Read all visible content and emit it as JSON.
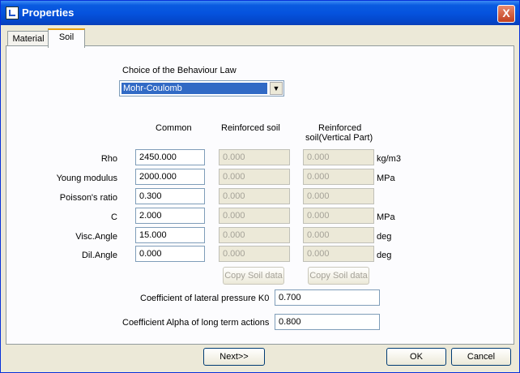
{
  "window": {
    "title": "Properties",
    "close_label": "X"
  },
  "tabs": [
    {
      "label": "Material"
    },
    {
      "label": "Soil"
    }
  ],
  "behaviour": {
    "label": "Choice of the Behaviour Law",
    "selected": "Mohr-Coulomb",
    "arrow": "▼"
  },
  "columns": {
    "common": "Common",
    "reinforced": "Reinforced soil",
    "vertical_line1": "Reinforced",
    "vertical_line2": "soil(Vertical Part)"
  },
  "rows": [
    {
      "label": "Rho",
      "common": "2450.000",
      "reinforced": "0.000",
      "vertical": "0.000",
      "unit": "kg/m3"
    },
    {
      "label": "Young modulus",
      "common": "2000.000",
      "reinforced": "0.000",
      "vertical": "0.000",
      "unit": "MPa"
    },
    {
      "label": "Poisson's ratio",
      "common": "0.300",
      "reinforced": "0.000",
      "vertical": "0.000",
      "unit": ""
    },
    {
      "label": "C",
      "common": "2.000",
      "reinforced": "0.000",
      "vertical": "0.000",
      "unit": "MPa"
    },
    {
      "label": "Visc.Angle",
      "common": "15.000",
      "reinforced": "0.000",
      "vertical": "0.000",
      "unit": "deg"
    },
    {
      "label": "Dil.Angle",
      "common": "0.000",
      "reinforced": "0.000",
      "vertical": "0.000",
      "unit": "deg"
    }
  ],
  "copy_buttons": {
    "reinforced": "Copy Soil data",
    "vertical": "Copy Soil data"
  },
  "k0": {
    "label": "Coefficient of lateral pressure K0",
    "value": "0.700"
  },
  "alpha": {
    "label": "Coefficient Alpha of long term actions",
    "value": "0.800"
  },
  "footer": {
    "next": "Next>>",
    "ok": "OK",
    "cancel": "Cancel"
  }
}
